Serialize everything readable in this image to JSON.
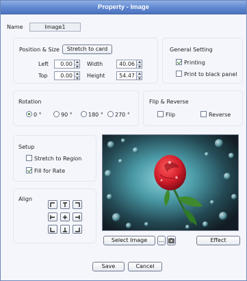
{
  "window": {
    "title": "Property - Image"
  },
  "name": {
    "label": "Name",
    "value": "Image1"
  },
  "position_size": {
    "title": "Position & Size",
    "stretch_label": "Stretch to card",
    "left_label": "Left",
    "left_value": "0.00",
    "top_label": "Top",
    "top_value": "0.00",
    "width_label": "Width",
    "width_value": "40.06",
    "height_label": "Height",
    "height_value": "54.47"
  },
  "general": {
    "title": "General Setting",
    "printing_label": "Printing",
    "printing_checked": true,
    "black_panel_label": "Print to black panel",
    "black_panel_checked": false
  },
  "rotation": {
    "title": "Rotation",
    "options": [
      {
        "label": "0 °",
        "selected": true
      },
      {
        "label": "90 °",
        "selected": false
      },
      {
        "label": "180 °",
        "selected": false
      },
      {
        "label": "270 °",
        "selected": false
      }
    ]
  },
  "flip": {
    "title": "Flip & Reverse",
    "flip_label": "Flip",
    "reverse_label": "Reverse"
  },
  "setup": {
    "title": "Setup",
    "stretch_label": "Stretch to Region",
    "stretch_checked": false,
    "fill_label": "Fill for Rate",
    "fill_checked": true
  },
  "align": {
    "title": "Align"
  },
  "image_actions": {
    "select_label": "Select Image",
    "browse_label": "...",
    "effect_label": "Effect"
  },
  "footer": {
    "save_label": "Save",
    "cancel_label": "Cancel"
  },
  "colors": {
    "title_bar": "#5f86cf",
    "accent_check": "#2d7a2d",
    "rose": "#d01c2a"
  },
  "icons": {
    "browse": "ellipsis-icon",
    "camera": "camera-icon"
  }
}
